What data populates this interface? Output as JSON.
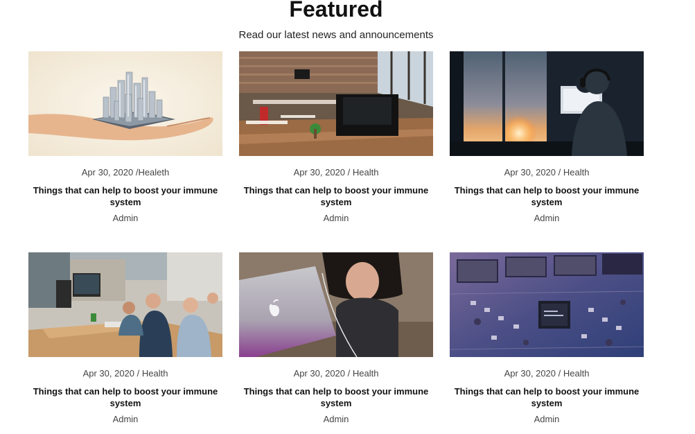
{
  "header": {
    "title": "Featured",
    "subtitle": "Read our latest news and announcements"
  },
  "posts": [
    {
      "image": "hand-holding-city-tablet",
      "date": "Apr 30, 2020",
      "sep": " /",
      "category": "Healeth",
      "title": "Things that can help to boost your immune system",
      "author": "Admin"
    },
    {
      "image": "open-office-desks",
      "date": "Apr 30, 2020",
      "sep": " / ",
      "category": "Health",
      "title": "Things that can help to boost your immune system",
      "author": "Admin"
    },
    {
      "image": "person-headphones-sunset",
      "date": "Apr 30, 2020",
      "sep": " / ",
      "category": "Health",
      "title": "Things that can help to boost your immune system",
      "author": "Admin"
    },
    {
      "image": "team-meeting-office",
      "date": "Apr 30, 2020",
      "sep": " / ",
      "category": "Health",
      "title": "Things that can help to boost your immune system",
      "author": "Admin"
    },
    {
      "image": "woman-with-laptop",
      "date": "Apr 30, 2020",
      "sep": " / ",
      "category": "Health",
      "title": "Things that can help to boost your immune system",
      "author": "Admin"
    },
    {
      "image": "circuit-board-chip",
      "date": "Apr 30, 2020",
      "sep": " / ",
      "category": "Health",
      "title": "Things that can help to boost your immune system",
      "author": "Admin"
    }
  ]
}
